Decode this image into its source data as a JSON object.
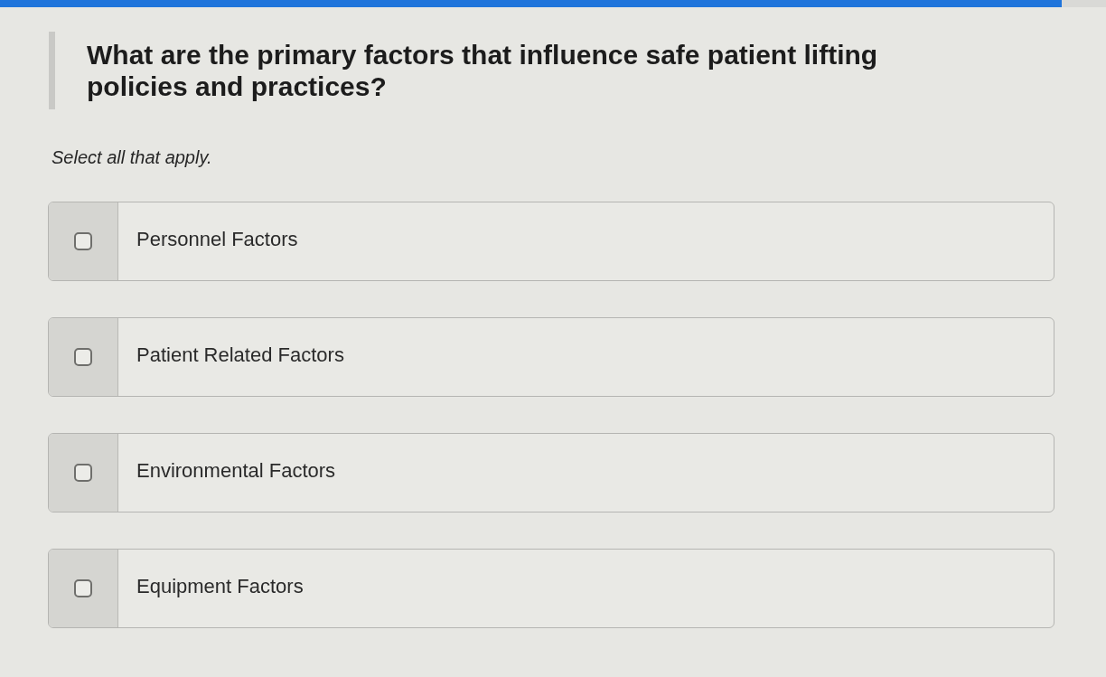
{
  "progress": {
    "level": 0.96
  },
  "question": {
    "text": "What are the primary factors that influence safe patient lifting policies and practices?"
  },
  "instruction": "Select all that apply.",
  "options": [
    {
      "label": "Personnel Factors",
      "checked": false
    },
    {
      "label": "Patient Related Factors",
      "checked": false
    },
    {
      "label": "Environmental Factors",
      "checked": false
    },
    {
      "label": "Equipment Factors",
      "checked": false
    }
  ]
}
